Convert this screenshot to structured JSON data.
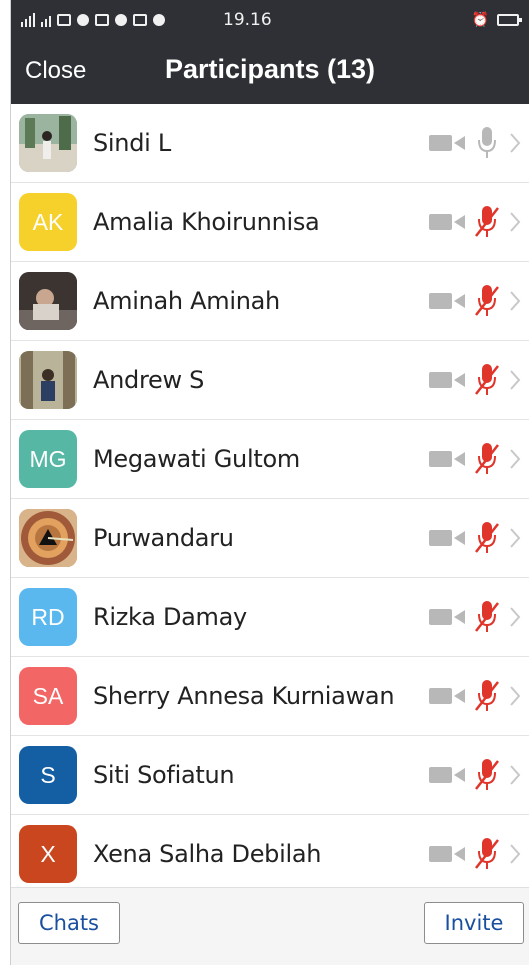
{
  "status_bar": {
    "time": "19.16"
  },
  "header": {
    "close_label": "Close",
    "title": "Participants (13)"
  },
  "participants": [
    {
      "name": "Sindi L",
      "avatar_type": "photo",
      "avatar_initials": "",
      "avatar_color": "#7e9a84",
      "mic_muted": false
    },
    {
      "name": "Amalia Khoirunnisa",
      "avatar_type": "initials",
      "avatar_initials": "AK",
      "avatar_color": "#f6d12b",
      "mic_muted": true
    },
    {
      "name": "Aminah Aminah",
      "avatar_type": "photo",
      "avatar_initials": "",
      "avatar_color": "#5b5350",
      "mic_muted": true
    },
    {
      "name": "Andrew S",
      "avatar_type": "photo",
      "avatar_initials": "",
      "avatar_color": "#8c8a7c",
      "mic_muted": true
    },
    {
      "name": "Megawati Gultom",
      "avatar_type": "initials",
      "avatar_initials": "MG",
      "avatar_color": "#56b7a5",
      "mic_muted": true
    },
    {
      "name": "Purwandaru",
      "avatar_type": "photo",
      "avatar_initials": "",
      "avatar_color": "#c77c4e",
      "mic_muted": true
    },
    {
      "name": "Rizka Damay",
      "avatar_type": "initials",
      "avatar_initials": "RD",
      "avatar_color": "#5bb8ef",
      "mic_muted": true
    },
    {
      "name": "Sherry Annesa Kurniawan",
      "avatar_type": "initials",
      "avatar_initials": "SA",
      "avatar_color": "#f26666",
      "mic_muted": true
    },
    {
      "name": "Siti Sofiatun",
      "avatar_type": "initials",
      "avatar_initials": "S",
      "avatar_color": "#145ea3",
      "mic_muted": true
    },
    {
      "name": "Xena Salha Debilah",
      "avatar_type": "initials",
      "avatar_initials": "X",
      "avatar_color": "#c9461e",
      "mic_muted": true
    }
  ],
  "icons": {
    "video": "video-camera-icon",
    "mic_on": "microphone-icon",
    "mic_muted": "microphone-muted-icon",
    "chevron": "chevron-right-icon"
  },
  "colors": {
    "header_bg": "#2f3036",
    "muted_red": "#e0352b",
    "icon_gray": "#b8b8b8",
    "button_text": "#1a4fa0"
  },
  "footer": {
    "chats_label": "Chats",
    "invite_label": "Invite"
  }
}
